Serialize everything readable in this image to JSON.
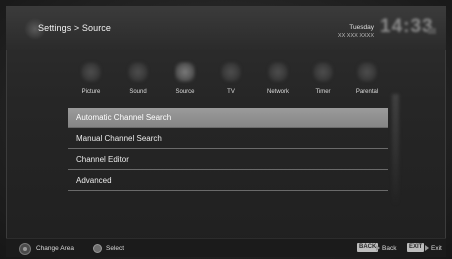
{
  "header": {
    "breadcrumb": "Settings > Source",
    "day": "Tuesday",
    "date": "XX XXX XXXX",
    "clock": "14:33"
  },
  "tabs": [
    {
      "label": "Picture",
      "icon": "picture-icon"
    },
    {
      "label": "Sound",
      "icon": "sound-icon"
    },
    {
      "label": "Source",
      "icon": "source-icon",
      "active": true
    },
    {
      "label": "TV",
      "icon": "tv-icon"
    },
    {
      "label": "Network",
      "icon": "network-icon"
    },
    {
      "label": "Timer",
      "icon": "timer-icon"
    },
    {
      "label": "Parental",
      "icon": "parental-icon"
    }
  ],
  "menu": {
    "items": [
      {
        "label": "Automatic Channel Search",
        "selected": true
      },
      {
        "label": "Manual Channel Search"
      },
      {
        "label": "Channel Editor"
      },
      {
        "label": "Advanced"
      }
    ]
  },
  "footer": {
    "change_area": "Change Area",
    "select": "Select",
    "back_key": "BACK",
    "back": "Back",
    "exit_key": "EXIT",
    "exit": "Exit"
  },
  "colors": {
    "background": "#242424",
    "selection": "#8f8f8f",
    "text": "#ececec",
    "divider": "#6a6a6a"
  }
}
